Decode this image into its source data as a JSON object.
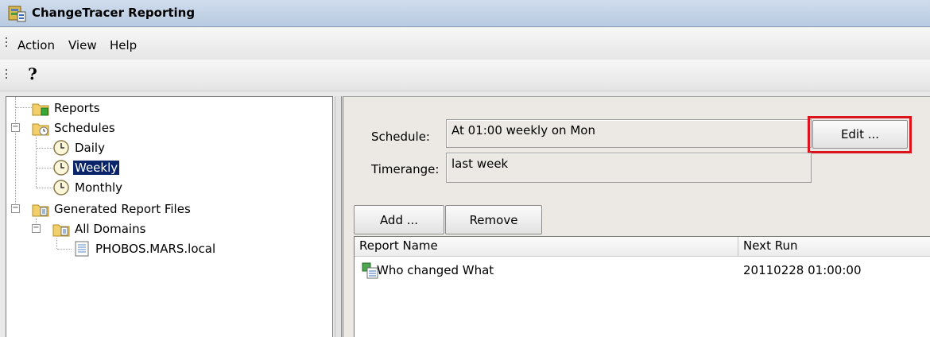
{
  "window": {
    "title": "ChangeTracer Reporting",
    "icon": "app-icon"
  },
  "menu": {
    "items": [
      "Action",
      "View",
      "Help"
    ]
  },
  "toolbar": {
    "help_icon": "help-icon",
    "help_glyph": "?"
  },
  "tree": {
    "items": [
      {
        "label": "Reports",
        "icon": "reports-folder-icon"
      },
      {
        "label": "Schedules",
        "icon": "schedules-folder-icon"
      },
      {
        "label": "Daily",
        "icon": "clock-icon"
      },
      {
        "label": "Weekly",
        "icon": "clock-icon",
        "selected": true
      },
      {
        "label": "Monthly",
        "icon": "clock-icon"
      },
      {
        "label": "Generated Report Files",
        "icon": "folder-icon"
      },
      {
        "label": "All Domains",
        "icon": "folder-icon"
      },
      {
        "label": "PHOBOS.MARS.local",
        "icon": "document-icon"
      }
    ]
  },
  "details": {
    "schedule_label": "Schedule:",
    "schedule_value": "At 01:00 weekly on Mon",
    "edit_button": "Edit ...",
    "timerange_label": "Timerange:",
    "timerange_value": "last week",
    "add_button": "Add ...",
    "remove_button": "Remove",
    "columns": [
      "Report Name",
      "Next Run"
    ],
    "rows": [
      {
        "name": "Who changed What",
        "next_run": "20110228 01:00:00"
      }
    ]
  },
  "colors": {
    "selection": "#0a246a",
    "highlight_border": "#d9141c"
  }
}
